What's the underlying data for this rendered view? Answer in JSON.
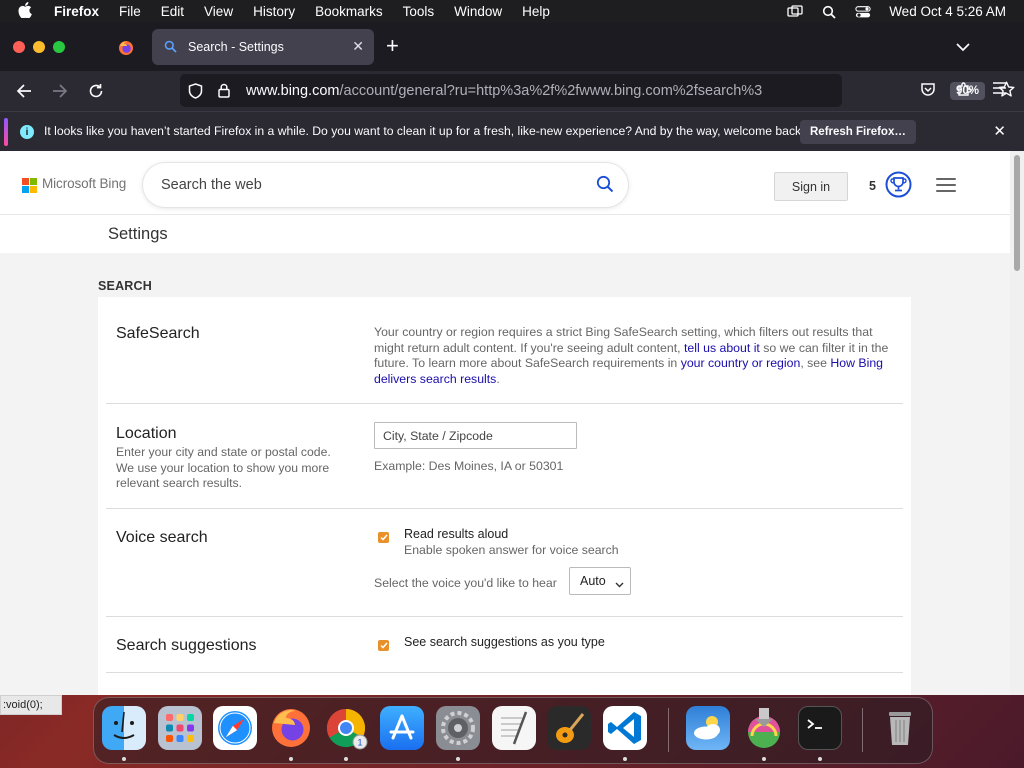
{
  "menubar": {
    "app": "Firefox",
    "items": [
      "File",
      "Edit",
      "View",
      "History",
      "Bookmarks",
      "Tools",
      "Window",
      "Help"
    ],
    "clock": "Wed Oct 4  5:26 AM"
  },
  "browser": {
    "tab_title": "Search - Settings",
    "new_tab_symbol": "+",
    "url_host": "www.bing.com",
    "url_path": "/account/general?ru=http%3a%2f%2fwww.bing.com%2fsearch%3",
    "zoom": "90%"
  },
  "notification": {
    "message": "It looks like you haven’t started Firefox in a while. Do you want to clean it up for a fresh, like-new experience? And by the way, welcome back!",
    "button": "Refresh Firefox…"
  },
  "bing": {
    "brand": "Microsoft Bing",
    "search_placeholder": "Search the web",
    "sign_in": "Sign in",
    "rewards_count": "5",
    "settings_title": "Settings",
    "section_label": "SEARCH"
  },
  "safesearch": {
    "title": "SafeSearch",
    "text_1": "Your country or region requires a strict Bing SafeSearch setting, which filters out results that might return adult content. If you're seeing adult content, ",
    "link_1": "tell us about it",
    "text_2": " so we can filter it in the future. To learn more about SafeSearch requirements in ",
    "link_2": "your country or region",
    "text_3": ", see ",
    "link_3": "How Bing delivers search results",
    "text_4": "."
  },
  "location": {
    "title": "Location",
    "description": "Enter your city and state or postal code. We use your location to show you more relevant search results.",
    "placeholder": "City, State / Zipcode",
    "example": "Example: Des Moines, IA or 50301"
  },
  "voice": {
    "title": "Voice search",
    "checkbox_label": "Read results aloud",
    "checkbox_sub": "Enable spoken answer for voice search",
    "select_label": "Select the voice you'd like to hear",
    "select_value": "Auto"
  },
  "suggestions": {
    "title": "Search suggestions",
    "checkbox_label": "See search suggestions as you type"
  },
  "status_text": ":void(0);",
  "colors": {
    "accent_orange": "#e8912a",
    "link_blue": "#1a0dab",
    "bing_blue": "#1d4ed8"
  }
}
